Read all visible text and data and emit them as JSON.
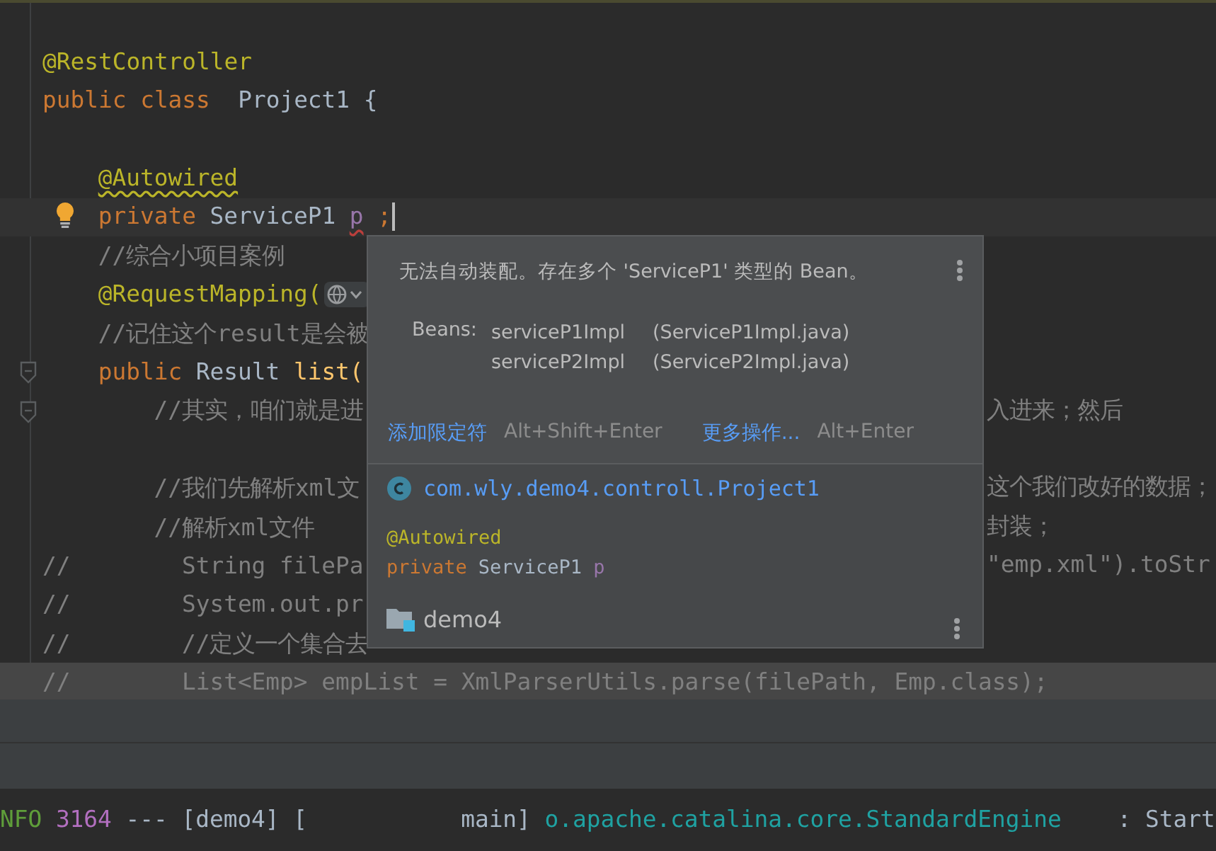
{
  "editor": {
    "lines": [
      {
        "kind": "code",
        "bulb": false,
        "fold": false,
        "caret": false,
        "highlighted": false,
        "tokens": [
          {
            "kind": "annotation",
            "text": "@RestController",
            "squiggled": false
          }
        ]
      },
      {
        "kind": "code",
        "bulb": false,
        "fold": false,
        "caret": false,
        "highlighted": false,
        "tokens": [
          {
            "kind": "keyword",
            "text": "public class",
            "squiggled": false
          },
          {
            "kind": "plain",
            "text": "  Project1 {",
            "squiggled": false
          }
        ]
      },
      {
        "kind": "blank"
      },
      {
        "kind": "code",
        "bulb": false,
        "fold": false,
        "caret": false,
        "highlighted": false,
        "tokens": [
          {
            "kind": "annotation",
            "text": "    @Autowired",
            "squiggled": true
          }
        ]
      },
      {
        "kind": "code",
        "bulb": true,
        "fold": false,
        "caret": true,
        "highlighted": false,
        "tokens": [
          {
            "kind": "keyword",
            "text": "    private",
            "squiggled": false
          },
          {
            "kind": "plain",
            "text": " ServiceP1",
            "squiggled": false
          },
          {
            "kind": "field",
            "text": " p",
            "squiggled": true
          },
          {
            "kind": "keyword",
            "text": " ;",
            "squiggled": false
          }
        ]
      },
      {
        "kind": "code",
        "bulb": false,
        "fold": false,
        "caret": false,
        "highlighted": false,
        "tokens": [
          {
            "kind": "comment",
            "text": "    //综合小项目案例",
            "squiggled": false
          }
        ]
      },
      {
        "kind": "code",
        "bulb": false,
        "fold": false,
        "caret": false,
        "highlighted": false,
        "tokens": [
          {
            "kind": "annotation",
            "text": "    @RequestMapping(",
            "squiggled": false
          },
          {
            "kind": "url-icon"
          }
        ]
      },
      {
        "kind": "code",
        "bulb": false,
        "fold": false,
        "caret": false,
        "highlighted": false,
        "tokens": [
          {
            "kind": "comment",
            "text": "    //记住这个result是会被",
            "squiggled": false
          }
        ]
      },
      {
        "kind": "code",
        "bulb": false,
        "fold": true,
        "caret": false,
        "highlighted": false,
        "tokens": [
          {
            "kind": "keyword",
            "text": "    public",
            "squiggled": false
          },
          {
            "kind": "plain",
            "text": " Result",
            "squiggled": false
          },
          {
            "kind": "method",
            "text": " list(",
            "squiggled": false
          }
        ]
      },
      {
        "kind": "code",
        "bulb": false,
        "fold": true,
        "caret": false,
        "highlighted": false,
        "tokens": [
          {
            "kind": "comment",
            "text": "        //其实，咱们就是进",
            "squiggled": false
          }
        ],
        "right": "入进来；然后"
      },
      {
        "kind": "blank"
      },
      {
        "kind": "code",
        "bulb": false,
        "fold": false,
        "caret": false,
        "highlighted": false,
        "tokens": [
          {
            "kind": "comment",
            "text": "        //我们先解析xml文",
            "squiggled": false
          }
        ],
        "right": "这个我们改好的数据；"
      },
      {
        "kind": "code",
        "bulb": false,
        "fold": false,
        "caret": false,
        "highlighted": false,
        "tokens": [
          {
            "kind": "comment",
            "text": "        //解析xml文件",
            "squiggled": false
          }
        ],
        "right": "封装；"
      },
      {
        "kind": "code",
        "bulb": false,
        "fold": false,
        "caret": false,
        "highlighted": false,
        "tokens": [
          {
            "kind": "comment",
            "text": "//",
            "squiggled": false
          },
          {
            "kind": "comment",
            "text": "        String filePa",
            "squiggled": false
          }
        ],
        "right": "\"emp.xml\").toStr"
      },
      {
        "kind": "code",
        "bulb": false,
        "fold": false,
        "caret": false,
        "highlighted": false,
        "tokens": [
          {
            "kind": "comment",
            "text": "//",
            "squiggled": false
          },
          {
            "kind": "comment",
            "text": "        System.out.pr",
            "squiggled": false
          }
        ]
      },
      {
        "kind": "code",
        "bulb": false,
        "fold": false,
        "caret": false,
        "highlighted": false,
        "tokens": [
          {
            "kind": "comment",
            "text": "//",
            "squiggled": false
          },
          {
            "kind": "comment",
            "text": "        //定义一个集合去",
            "squiggled": false
          }
        ]
      },
      {
        "kind": "code",
        "bulb": false,
        "fold": false,
        "caret": false,
        "highlighted": true,
        "tokens": [
          {
            "kind": "comment",
            "text": "//",
            "squiggled": false
          },
          {
            "kind": "comment",
            "text": "        List<Emp> empList = XmlParserUtils.parse(filePath, Emp.class);",
            "squiggled": false
          }
        ]
      }
    ]
  },
  "popup": {
    "message": "无法自动装配。存在多个 'ServiceP1' 类型的 Bean。",
    "beans_label": "Beans:",
    "beans": [
      {
        "name": "serviceP1Impl",
        "file": "(ServiceP1Impl.java)"
      },
      {
        "name": "serviceP2Impl",
        "file": "(ServiceP2Impl.java)"
      }
    ],
    "actions": [
      {
        "label": "添加限定符",
        "shortcut": "Alt+Shift+Enter"
      },
      {
        "label": "更多操作...",
        "shortcut": "Alt+Enter"
      }
    ],
    "class_name": "com.wly.demo4.controll.Project1",
    "annotation": "@Autowired",
    "declaration": [
      {
        "kind": "keyword",
        "text": "private"
      },
      {
        "kind": "plain",
        "text": "ServiceP1"
      },
      {
        "kind": "field",
        "text": "p"
      }
    ],
    "module": "demo4"
  },
  "console": {
    "lines": [
      {
        "tokens": [
          {
            "kind": "level",
            "text": "NFO"
          },
          {
            "kind": "pid",
            "text": " 3164"
          },
          {
            "kind": "plain",
            "text": " --- [demo4] [           main]"
          },
          {
            "kind": "logger",
            "text": " o.apache.catalina.core.StandardEngine"
          },
          {
            "kind": "plain",
            "text": "    : Start"
          }
        ]
      }
    ]
  }
}
